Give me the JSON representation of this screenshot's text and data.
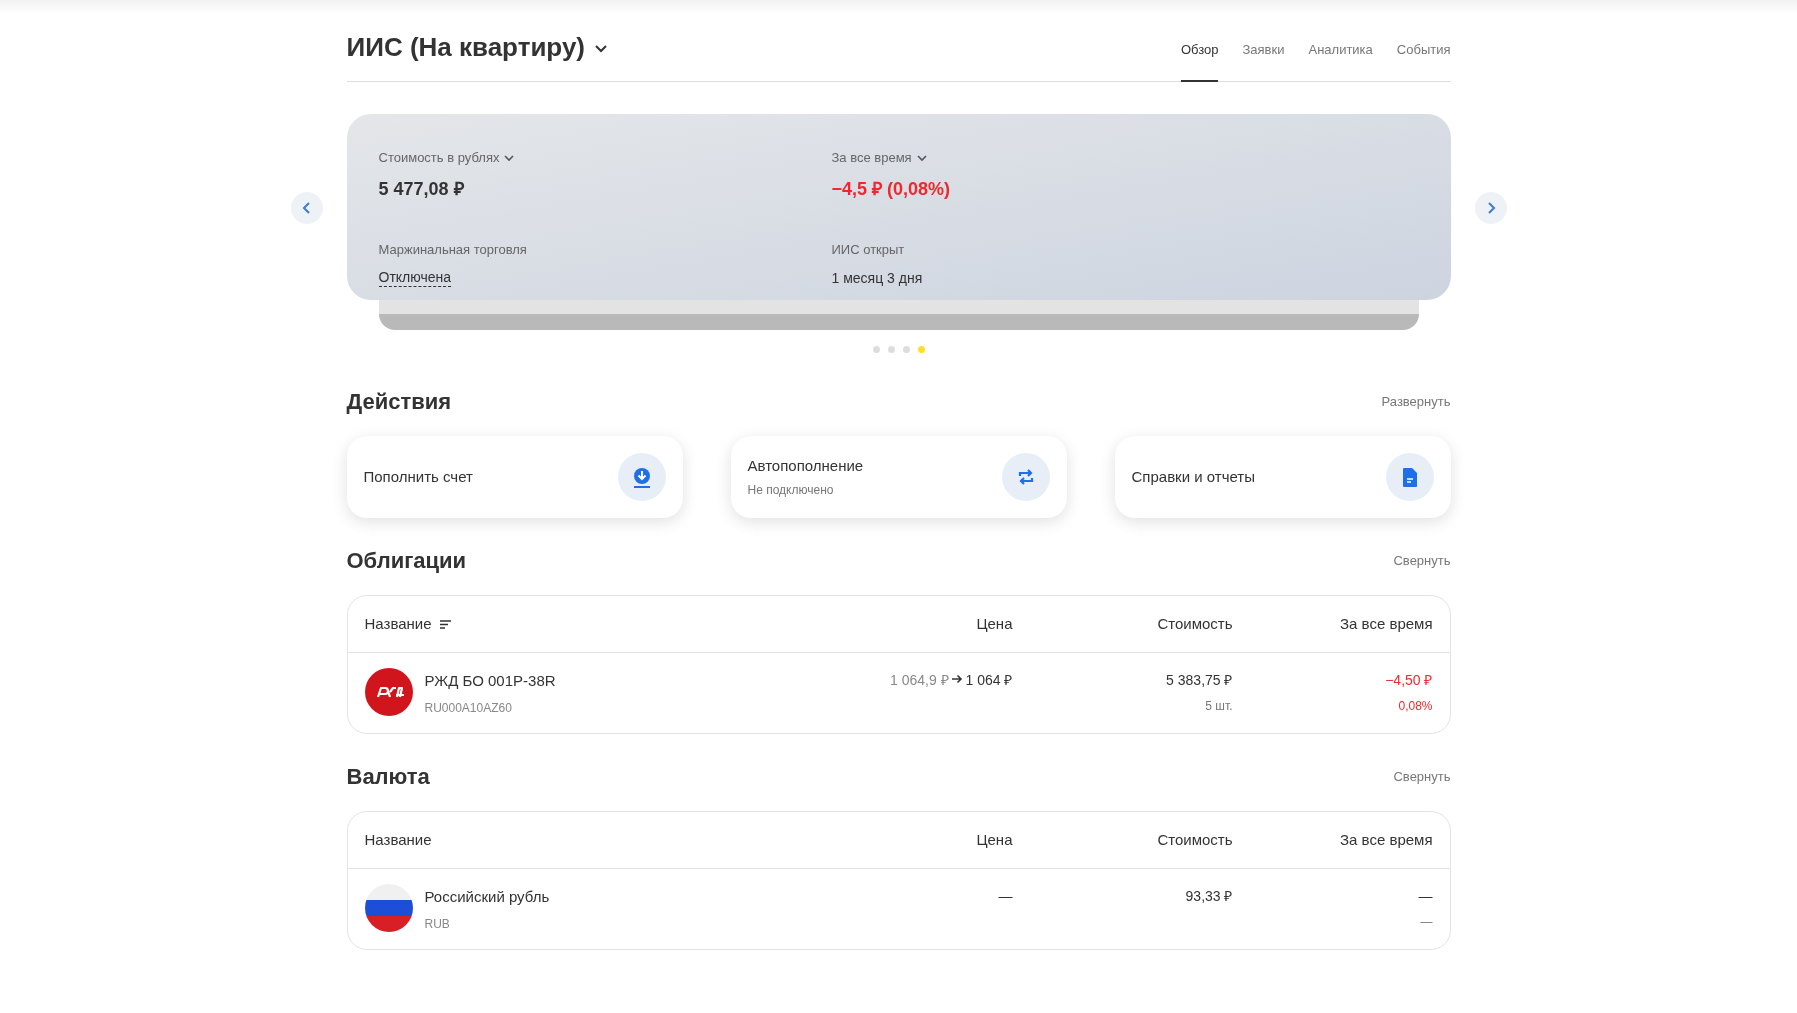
{
  "header": {
    "title": "ИИС (На квартиру)",
    "tabs": [
      {
        "label": "Обзор",
        "selected": true
      },
      {
        "label": "Заявки",
        "selected": false
      },
      {
        "label": "Аналитика",
        "selected": false
      },
      {
        "label": "События",
        "selected": false
      }
    ]
  },
  "summary": {
    "fields": [
      {
        "label": "Стоимость в рублях",
        "dropdown": true,
        "value": "5 477,08 ₽",
        "kind": "big",
        "negative": false
      },
      {
        "label": "За все время",
        "dropdown": true,
        "value": "−4,5 ₽ (0,08%)",
        "kind": "big",
        "negative": true
      },
      {
        "label": "Маржинальная торговля",
        "dropdown": false,
        "value": "Отключена",
        "kind": "link",
        "negative": false
      },
      {
        "label": "ИИС открыт",
        "dropdown": false,
        "value": "1 месяц 3 дня",
        "kind": "plain",
        "negative": false
      }
    ],
    "dots": [
      {
        "selected": false
      },
      {
        "selected": false
      },
      {
        "selected": false
      },
      {
        "selected": true
      }
    ]
  },
  "actions": {
    "title": "Действия",
    "toggle": "Развернуть",
    "items": [
      {
        "label": "Пополнить счет",
        "kind": "deposit"
      },
      {
        "label": "Автопополнение",
        "subtitle": "Не подключено",
        "kind": "auto"
      },
      {
        "label": "Справки и отчеты",
        "kind": "reports"
      }
    ]
  },
  "sections": [
    {
      "title": "Облигации",
      "toggle": "Свернуть",
      "columns": [
        {
          "label": "Название",
          "sortable": true
        },
        {
          "label": "Цена",
          "sortable": false
        },
        {
          "label": "Стоимость",
          "sortable": false
        },
        {
          "label": "За все время",
          "sortable": false
        }
      ],
      "rows": [
        {
          "kind": "rzd",
          "name": "РЖД БО 001P-38R",
          "code": "RU000A10AZ60",
          "price_old": "1 064,9 ₽",
          "price": "1 064 ₽",
          "value": "5 383,75 ₽",
          "quantity": "5 шт.",
          "change": "−4,50 ₽",
          "change_pct": "0,08%",
          "negative": true
        }
      ]
    },
    {
      "title": "Валюта",
      "toggle": "Свернуть",
      "columns": [
        {
          "label": "Название",
          "sortable": false
        },
        {
          "label": "Цена",
          "sortable": false
        },
        {
          "label": "Стоимость",
          "sortable": false
        },
        {
          "label": "За все время",
          "sortable": false
        }
      ],
      "rows": [
        {
          "kind": "flag",
          "name": "Российский рубль",
          "code": "RUB",
          "price": "—",
          "value": "93,33 ₽",
          "change": "—",
          "change_pct": "—",
          "negative": false
        }
      ]
    }
  ]
}
